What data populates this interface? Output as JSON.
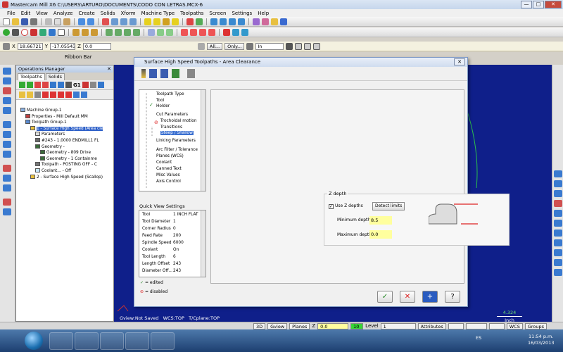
{
  "app": {
    "title": "Mastercam Mill X6  C:\\USERS\\ARTURO\\DOCUMENTS\\CODO CON LETRAS.MCX-6",
    "window_buttons": [
      "—",
      "□",
      "✕"
    ]
  },
  "menu": [
    "File",
    "Edit",
    "View",
    "Analyze",
    "Create",
    "Solids",
    "Xform",
    "Machine Type",
    "Toolpaths",
    "Screen",
    "Settings",
    "Help"
  ],
  "coords": {
    "x_label": "X",
    "x_value": "18.66721",
    "y_label": "Y",
    "y_value": "-17.05543",
    "z_label": "Z",
    "z_value": "0.0",
    "all_btn": "All...",
    "only_btn": "Only...",
    "mode_value": "In"
  },
  "ribbon_label": "Ribbon Bar",
  "ops_manager": {
    "title": "Operations Manager",
    "tabs": [
      "Toolpaths",
      "Solids"
    ],
    "tool_labels": [
      "G1"
    ],
    "tree": [
      {
        "text": "Machine Group-1",
        "indent": 0
      },
      {
        "text": "Properties - Mill Default MM",
        "indent": 1
      },
      {
        "text": "Toolpath Group-1",
        "indent": 1
      },
      {
        "text": "1 - Surface High Speed (Area cle",
        "indent": 2,
        "selected": true
      },
      {
        "text": "Parameters",
        "indent": 3
      },
      {
        "text": "#243 - 1.0000 ENDMILL1 FL",
        "indent": 3
      },
      {
        "text": "Geometry -",
        "indent": 3
      },
      {
        "text": "Geometry - 809 Drive",
        "indent": 4
      },
      {
        "text": "Geometry - 1 Containme",
        "indent": 4
      },
      {
        "text": "Toolpath - POSTING OFF - C",
        "indent": 3
      },
      {
        "text": "Coolant... - Off",
        "indent": 3
      },
      {
        "text": "2 - Surface High Speed (Scallop)",
        "indent": 2
      }
    ]
  },
  "graphics": {
    "gview": "Gview:Not Saved",
    "wcs": "WCS:TOP",
    "cplane": "T/Cplane:TOP",
    "scale_value": "4.324",
    "scale_unit": "Inch"
  },
  "dialog": {
    "title": "Surface High Speed Toolpaths - Area Clearance",
    "close_label": "✕",
    "nav_items": [
      {
        "label": "Toolpath Type"
      },
      {
        "label": "Tool"
      },
      {
        "label": "Holder"
      },
      {
        "label": "Cut Parameters"
      },
      {
        "label": "Trochoidal motion"
      },
      {
        "label": "Transitions"
      },
      {
        "label": "Steep / Shallow",
        "selected": true
      },
      {
        "label": "Linking Parameters"
      },
      {
        "label": "Arc Filter / Tolerance"
      },
      {
        "label": "Planes (WCS)"
      },
      {
        "label": "Coolant"
      },
      {
        "label": "Canned Text"
      },
      {
        "label": "Misc Values"
      },
      {
        "label": "Axis Control"
      }
    ],
    "quick_view_label": "Quick View Settings",
    "quick_view": [
      {
        "k": "Tool",
        "v": "1 INCH FLAT"
      },
      {
        "k": "Tool Diameter",
        "v": "1"
      },
      {
        "k": "Corner Radius",
        "v": "0"
      },
      {
        "k": "Feed Rate",
        "v": "200"
      },
      {
        "k": "Spindle Speed",
        "v": "6000"
      },
      {
        "k": "Coolant",
        "v": "On"
      },
      {
        "k": "Tool Length",
        "v": "6"
      },
      {
        "k": "Length Offset",
        "v": "243"
      },
      {
        "k": "Diameter Off...",
        "v": "243"
      }
    ],
    "legend_edited": "= edited",
    "legend_disabled": "= disabled",
    "zdepth": {
      "legend": "Z depth",
      "use_checkbox": "Use Z depths",
      "use_checked": true,
      "detect_btn": "Detect limits",
      "min_label": "Minimum depth",
      "min_value": "8.5",
      "max_label": "Maximum depth",
      "max_value": "0.0"
    },
    "buttons": {
      "ok": "✓",
      "cancel": "✕",
      "add": "+",
      "help": "?"
    }
  },
  "statusbar": {
    "view3d": "3D",
    "gview": "Gview",
    "planes": "Planes",
    "z_label": "Z",
    "z_value": "0.0",
    "color_value": "10",
    "level_label": "Level",
    "level_value": "1",
    "attributes": "Attributes",
    "wcs": "WCS",
    "groups": "Groups"
  },
  "taskbar": {
    "lang": "ES",
    "time": "11:54 p.m.",
    "date": "16/03/2013"
  },
  "colors": {
    "graphics_bg": "#0f1f8a",
    "selection": "#3062c9",
    "yellow_field": "#ffff9e",
    "toolpath_green": "#2bc04a"
  }
}
